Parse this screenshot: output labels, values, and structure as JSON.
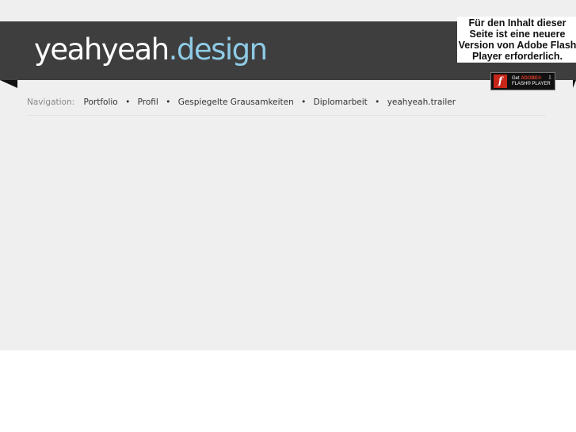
{
  "header": {
    "logo_main": "yeahyeah",
    "logo_suffix": ".design"
  },
  "flash": {
    "message": "Für den Inhalt dieser Seite ist eine neuere Version von Adobe Flash Player erforderlich.",
    "badge_get": "Get",
    "badge_adobe": "ADOBE®",
    "badge_product": "FLASH® PLAYER",
    "badge_logo": "f",
    "badge_icon": "download-icon"
  },
  "nav": {
    "label": "Navigation:",
    "separator": "•",
    "items": [
      {
        "label": "Portfolio"
      },
      {
        "label": "Profil"
      },
      {
        "label": "Gespiegelte Grausamkeiten"
      },
      {
        "label": "Diplomarbeit"
      },
      {
        "label": "yeahyeah.trailer"
      }
    ]
  },
  "colors": {
    "header_bg": "#3e3e3e",
    "page_bg": "#efefef",
    "logo_accent": "#8ecbe6",
    "flash_red": "#c8261b"
  }
}
